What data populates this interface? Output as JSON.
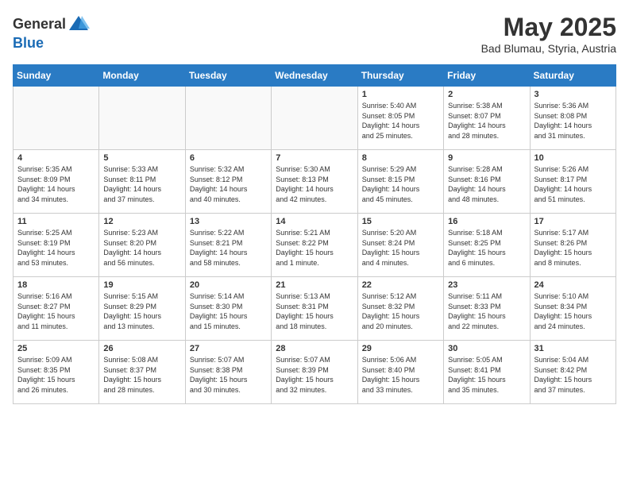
{
  "header": {
    "logo_general": "General",
    "logo_blue": "Blue",
    "month": "May 2025",
    "location": "Bad Blumau, Styria, Austria"
  },
  "days_of_week": [
    "Sunday",
    "Monday",
    "Tuesday",
    "Wednesday",
    "Thursday",
    "Friday",
    "Saturday"
  ],
  "weeks": [
    [
      {
        "day": "",
        "content": ""
      },
      {
        "day": "",
        "content": ""
      },
      {
        "day": "",
        "content": ""
      },
      {
        "day": "",
        "content": ""
      },
      {
        "day": "1",
        "content": "Sunrise: 5:40 AM\nSunset: 8:05 PM\nDaylight: 14 hours\nand 25 minutes."
      },
      {
        "day": "2",
        "content": "Sunrise: 5:38 AM\nSunset: 8:07 PM\nDaylight: 14 hours\nand 28 minutes."
      },
      {
        "day": "3",
        "content": "Sunrise: 5:36 AM\nSunset: 8:08 PM\nDaylight: 14 hours\nand 31 minutes."
      }
    ],
    [
      {
        "day": "4",
        "content": "Sunrise: 5:35 AM\nSunset: 8:09 PM\nDaylight: 14 hours\nand 34 minutes."
      },
      {
        "day": "5",
        "content": "Sunrise: 5:33 AM\nSunset: 8:11 PM\nDaylight: 14 hours\nand 37 minutes."
      },
      {
        "day": "6",
        "content": "Sunrise: 5:32 AM\nSunset: 8:12 PM\nDaylight: 14 hours\nand 40 minutes."
      },
      {
        "day": "7",
        "content": "Sunrise: 5:30 AM\nSunset: 8:13 PM\nDaylight: 14 hours\nand 42 minutes."
      },
      {
        "day": "8",
        "content": "Sunrise: 5:29 AM\nSunset: 8:15 PM\nDaylight: 14 hours\nand 45 minutes."
      },
      {
        "day": "9",
        "content": "Sunrise: 5:28 AM\nSunset: 8:16 PM\nDaylight: 14 hours\nand 48 minutes."
      },
      {
        "day": "10",
        "content": "Sunrise: 5:26 AM\nSunset: 8:17 PM\nDaylight: 14 hours\nand 51 minutes."
      }
    ],
    [
      {
        "day": "11",
        "content": "Sunrise: 5:25 AM\nSunset: 8:19 PM\nDaylight: 14 hours\nand 53 minutes."
      },
      {
        "day": "12",
        "content": "Sunrise: 5:23 AM\nSunset: 8:20 PM\nDaylight: 14 hours\nand 56 minutes."
      },
      {
        "day": "13",
        "content": "Sunrise: 5:22 AM\nSunset: 8:21 PM\nDaylight: 14 hours\nand 58 minutes."
      },
      {
        "day": "14",
        "content": "Sunrise: 5:21 AM\nSunset: 8:22 PM\nDaylight: 15 hours\nand 1 minute."
      },
      {
        "day": "15",
        "content": "Sunrise: 5:20 AM\nSunset: 8:24 PM\nDaylight: 15 hours\nand 4 minutes."
      },
      {
        "day": "16",
        "content": "Sunrise: 5:18 AM\nSunset: 8:25 PM\nDaylight: 15 hours\nand 6 minutes."
      },
      {
        "day": "17",
        "content": "Sunrise: 5:17 AM\nSunset: 8:26 PM\nDaylight: 15 hours\nand 8 minutes."
      }
    ],
    [
      {
        "day": "18",
        "content": "Sunrise: 5:16 AM\nSunset: 8:27 PM\nDaylight: 15 hours\nand 11 minutes."
      },
      {
        "day": "19",
        "content": "Sunrise: 5:15 AM\nSunset: 8:29 PM\nDaylight: 15 hours\nand 13 minutes."
      },
      {
        "day": "20",
        "content": "Sunrise: 5:14 AM\nSunset: 8:30 PM\nDaylight: 15 hours\nand 15 minutes."
      },
      {
        "day": "21",
        "content": "Sunrise: 5:13 AM\nSunset: 8:31 PM\nDaylight: 15 hours\nand 18 minutes."
      },
      {
        "day": "22",
        "content": "Sunrise: 5:12 AM\nSunset: 8:32 PM\nDaylight: 15 hours\nand 20 minutes."
      },
      {
        "day": "23",
        "content": "Sunrise: 5:11 AM\nSunset: 8:33 PM\nDaylight: 15 hours\nand 22 minutes."
      },
      {
        "day": "24",
        "content": "Sunrise: 5:10 AM\nSunset: 8:34 PM\nDaylight: 15 hours\nand 24 minutes."
      }
    ],
    [
      {
        "day": "25",
        "content": "Sunrise: 5:09 AM\nSunset: 8:35 PM\nDaylight: 15 hours\nand 26 minutes."
      },
      {
        "day": "26",
        "content": "Sunrise: 5:08 AM\nSunset: 8:37 PM\nDaylight: 15 hours\nand 28 minutes."
      },
      {
        "day": "27",
        "content": "Sunrise: 5:07 AM\nSunset: 8:38 PM\nDaylight: 15 hours\nand 30 minutes."
      },
      {
        "day": "28",
        "content": "Sunrise: 5:07 AM\nSunset: 8:39 PM\nDaylight: 15 hours\nand 32 minutes."
      },
      {
        "day": "29",
        "content": "Sunrise: 5:06 AM\nSunset: 8:40 PM\nDaylight: 15 hours\nand 33 minutes."
      },
      {
        "day": "30",
        "content": "Sunrise: 5:05 AM\nSunset: 8:41 PM\nDaylight: 15 hours\nand 35 minutes."
      },
      {
        "day": "31",
        "content": "Sunrise: 5:04 AM\nSunset: 8:42 PM\nDaylight: 15 hours\nand 37 minutes."
      }
    ]
  ]
}
